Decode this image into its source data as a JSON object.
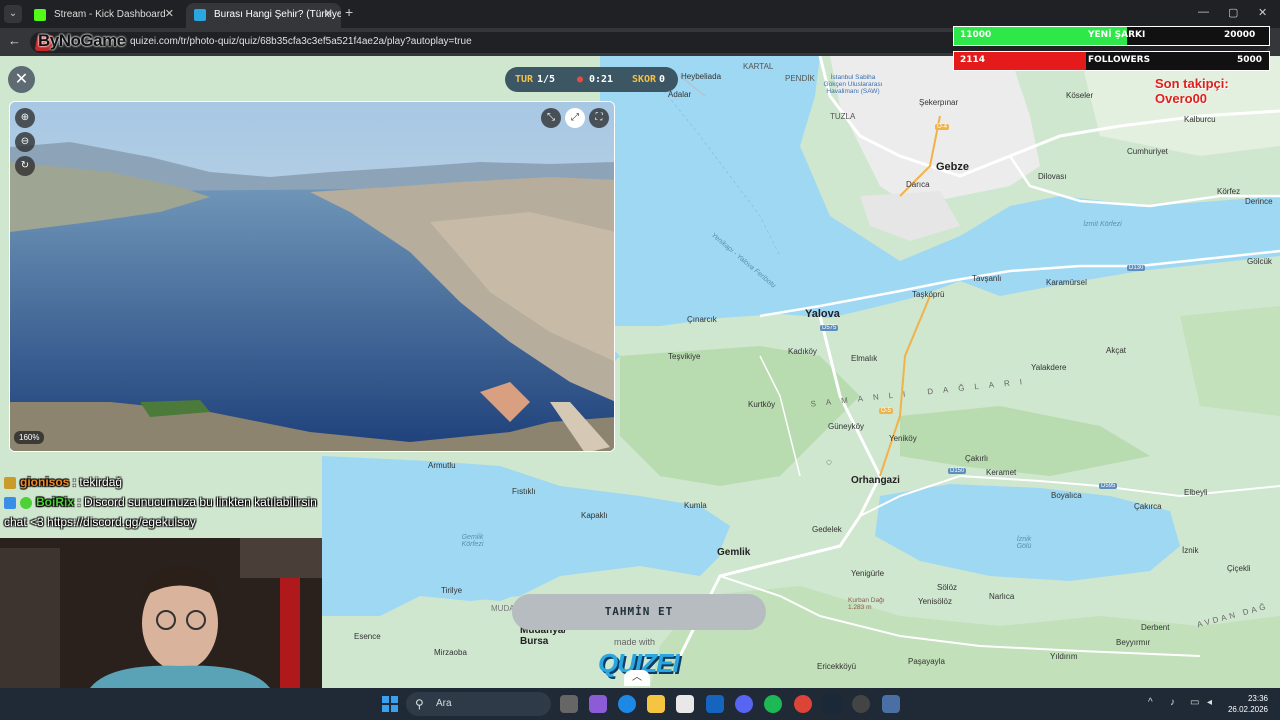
{
  "browser": {
    "tabs": [
      {
        "title": "Stream - Kick Dashboard",
        "favicon_color": "#53fc18"
      },
      {
        "title": "Burası Hangi Şehir? (Türkiye) - (",
        "favicon_color": "#2aa7e0"
      }
    ],
    "new_tab": "+",
    "url": "quizei.com/tr/photo-quiz/quiz/68b35cfa3c3ef5a521f4ae2a/play?autoplay=true",
    "window_controls": [
      "—",
      "▢",
      "✕"
    ]
  },
  "stream_logo": "ByNoGame",
  "quiz": {
    "close_label": "✕",
    "round_label": "TUR",
    "round_value": "1/5",
    "time_value": "0:21",
    "score_label": "SKOR",
    "score_value": "0",
    "photo_zoom": "160%",
    "guess_button": "TAHMİN ET",
    "made_with": "made with",
    "brand": "QUIZEI"
  },
  "map": {
    "places": [
      {
        "name": "Heybeliada"
      },
      {
        "name": "Adalar"
      },
      {
        "name": "KARTAL"
      },
      {
        "name": "PENDİK"
      },
      {
        "name": "İstanbul Sabiha Gökçen Uluslararası Havalimanı (SAW)"
      },
      {
        "name": "TUZLA"
      },
      {
        "name": "Şekerpınar"
      },
      {
        "name": "Köseler"
      },
      {
        "name": "Kalburcu"
      },
      {
        "name": "Gebze",
        "big": true
      },
      {
        "name": "Darıca"
      },
      {
        "name": "Cumhuriyet"
      },
      {
        "name": "Dilovası"
      },
      {
        "name": "Körfez"
      },
      {
        "name": "Derince"
      },
      {
        "name": "İzmit Körfezi",
        "water": true
      },
      {
        "name": "Gölcük"
      },
      {
        "name": "Yenikapı - Yalova Feribotu",
        "water": true
      },
      {
        "name": "Tavşanlı"
      },
      {
        "name": "Karamürsel"
      },
      {
        "name": "Taşköprü"
      },
      {
        "name": "Çınarcık"
      },
      {
        "name": "Yalova",
        "big": true
      },
      {
        "name": "Teşvikiye"
      },
      {
        "name": "Kadıköy"
      },
      {
        "name": "Elmalık"
      },
      {
        "name": "Yalakdere"
      },
      {
        "name": "Akçat"
      },
      {
        "name": "Kurtköy"
      },
      {
        "name": "SAMANLI DAĞLARI",
        "range": true
      },
      {
        "name": "Güneyköy"
      },
      {
        "name": "Yeniköy"
      },
      {
        "name": "Çakırlı"
      },
      {
        "name": "Keramet"
      },
      {
        "name": "Armutlu"
      },
      {
        "name": "Fıstıklı"
      },
      {
        "name": "Orhangazi",
        "big": true
      },
      {
        "name": "Boyalıca"
      },
      {
        "name": "Elbeyli"
      },
      {
        "name": "Kapaklı"
      },
      {
        "name": "Kumla"
      },
      {
        "name": "Çakırca"
      },
      {
        "name": "Gedelek"
      },
      {
        "name": "Gemlik Körfezi",
        "water": true
      },
      {
        "name": "İznik Gölü",
        "water": true
      },
      {
        "name": "Gemlik",
        "big": true
      },
      {
        "name": "İznik"
      },
      {
        "name": "Çiçekli"
      },
      {
        "name": "Yenigürle"
      },
      {
        "name": "Tirilye"
      },
      {
        "name": "Sölöz"
      },
      {
        "name": "Yenisölöz"
      },
      {
        "name": "Narlıca"
      },
      {
        "name": "Kurban Dağı 1.283 m"
      },
      {
        "name": "MUDA"
      },
      {
        "name": "Mudanya/ Bursa",
        "big": true
      },
      {
        "name": "Esence"
      },
      {
        "name": "Derbent"
      },
      {
        "name": "AVDAN DAĞ",
        "range": true
      },
      {
        "name": "Mirzaoba"
      },
      {
        "name": "Beyyırmır"
      },
      {
        "name": "Ericekköyü"
      },
      {
        "name": "Paşayayla"
      },
      {
        "name": "Yıldırım"
      }
    ],
    "road_labels": [
      "D575",
      "O-4",
      "D130",
      "O-5",
      "D150",
      "D595"
    ],
    "colors": {
      "land": "#cfe6cf",
      "water": "#9fd8f3",
      "urban": "#ececec",
      "road": "#ffffff",
      "highway": "#f2b24a"
    }
  },
  "overlay": {
    "goal1": {
      "current": "11000",
      "label": "YENİ ŞARKI",
      "target": "20000",
      "color": "#2ee84a",
      "progress": 0.55
    },
    "goal2": {
      "current": "2114",
      "label": "FOLLOWERS",
      "target": "5000",
      "color": "#e51b1b",
      "progress": 0.42
    },
    "last_follower": "Son takipçi: Overo00"
  },
  "chat": [
    {
      "user": "gionisos",
      "separator": " : ",
      "message": "tekirdağ"
    },
    {
      "user": "BoiRix",
      "separator": " : ",
      "message": "Discord sunucumuza bu linkten katılabilirsin chat <3 https://discord.gg/egekulsoy"
    }
  ],
  "taskbar": {
    "search_placeholder": "Ara",
    "time": "23:36",
    "date": "26.02.2026"
  }
}
